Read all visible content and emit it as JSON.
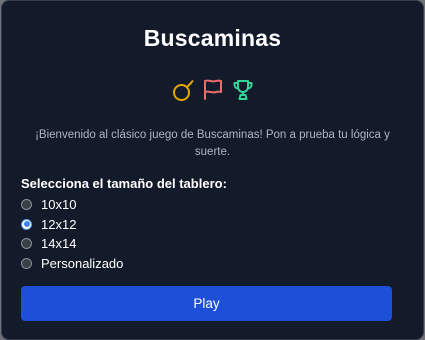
{
  "game": {
    "title": "Buscaminas",
    "welcome": "¡Bienvenido al clásico juego de Buscaminas! Pon a prueba tu lógica y suerte."
  },
  "icons": [
    {
      "name": "bomb-icon",
      "color": "#e0a800"
    },
    {
      "name": "flag-icon",
      "color": "#f26b6b"
    },
    {
      "name": "trophy-icon",
      "color": "#34d399"
    }
  ],
  "board_size": {
    "label": "Selecciona el tamaño del tablero:",
    "selected": "12x12",
    "options": [
      {
        "label": "10x10"
      },
      {
        "label": "12x12"
      },
      {
        "label": "14x14"
      },
      {
        "label": "Personalizado"
      }
    ]
  },
  "actions": {
    "play_label": "Play"
  },
  "colors": {
    "background": "#131a2a",
    "accent": "#1d4fd8"
  }
}
